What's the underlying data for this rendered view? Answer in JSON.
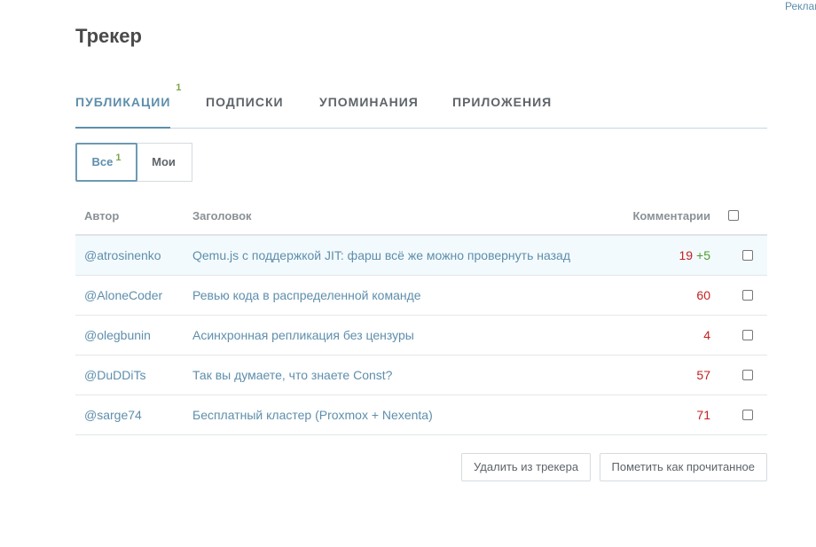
{
  "ad_label": "Реклама",
  "page_title": "Трекер",
  "tabs": [
    {
      "label": "Публикации",
      "counter": "1",
      "active": true
    },
    {
      "label": "Подписки",
      "counter": "",
      "active": false
    },
    {
      "label": "Упоминания",
      "counter": "",
      "active": false
    },
    {
      "label": "Приложения",
      "counter": "",
      "active": false
    }
  ],
  "filters": [
    {
      "label": "Все",
      "counter": "1",
      "active": true
    },
    {
      "label": "Мои",
      "counter": "",
      "active": false
    }
  ],
  "table": {
    "headers": {
      "author": "Автор",
      "title": "Заголовок",
      "comments": "Комментарии"
    },
    "rows": [
      {
        "author": "@atrosinenko",
        "title": "Qemu.js с поддержкой JIT: фарш всё же можно провернуть назад",
        "comments": "19",
        "new_comments": "+5",
        "highlight": true
      },
      {
        "author": "@AloneCoder",
        "title": "Ревью кода в распределенной команде",
        "comments": "60",
        "new_comments": "",
        "highlight": false
      },
      {
        "author": "@olegbunin",
        "title": "Асинхронная репликация без цензуры",
        "comments": "4",
        "new_comments": "",
        "highlight": false
      },
      {
        "author": "@DuDDiTs",
        "title": "Так вы думаете, что знаете Const?",
        "comments": "57",
        "new_comments": "",
        "highlight": false
      },
      {
        "author": "@sarge74",
        "title": "Бесплатный кластер (Proxmox + Nexenta)",
        "comments": "71",
        "new_comments": "",
        "highlight": false
      }
    ]
  },
  "actions": {
    "remove_label": "Удалить из трекера",
    "mark_read_label": "Пометить как прочитанное"
  },
  "colors": {
    "accent": "#5e8eac",
    "counter_green": "#7ba44a",
    "comments_red": "#c22121",
    "new_comments_green": "#4f9a32"
  }
}
